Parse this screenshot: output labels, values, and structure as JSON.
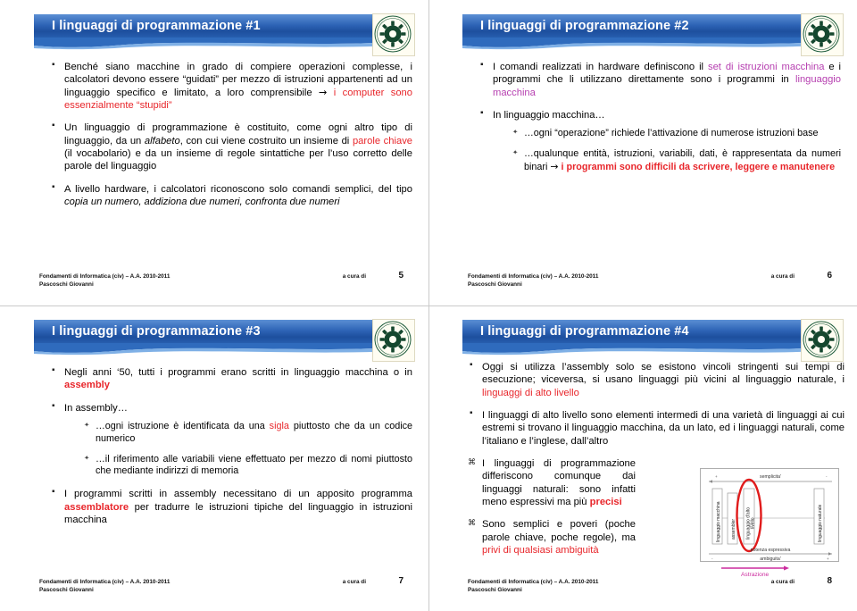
{
  "deck": {
    "logo_name": "polytechnic-gear-seal-logo",
    "colors": {
      "banner_blue_dark": "#1d4f9e",
      "banner_blue_light": "#5b8fd4",
      "highlight_red": "#e8262b",
      "highlight_magenta": "#b63fb0",
      "logo_green": "#1d5c3c"
    }
  },
  "footer_common": {
    "left_line1": "Fondamenti di Informatica (civ) – A.A. 2010-2011",
    "left_line2": "Pascoschi Giovanni",
    "center": "a cura di"
  },
  "slides": [
    {
      "title": "I linguaggi di programmazione #1",
      "page": "5",
      "bullets": [
        {
          "parts": [
            {
              "t": "Benché siano macchine in grado di compiere operazioni complesse, i calcolatori devono essere “guidati” per mezzo di istruzioni appartenenti ad un linguaggio specifico e limitato, a loro comprensibile ",
              "s": "normal"
            },
            {
              "t": "→ ",
              "s": "arrow"
            },
            {
              "t": "i computer sono essenzialmente “stupidi”",
              "s": "red"
            }
          ]
        },
        {
          "parts": [
            {
              "t": "Un linguaggio di programmazione è costituito, come ogni altro tipo di linguaggio, da un ",
              "s": "normal"
            },
            {
              "t": "alfabeto",
              "s": "italic"
            },
            {
              "t": ", con cui viene costruito un insieme di ",
              "s": "normal"
            },
            {
              "t": "parole chiave",
              "s": "red"
            },
            {
              "t": " (il vocabolario) e da un insieme di regole sintattiche per l’uso corretto delle parole del linguaggio",
              "s": "normal"
            }
          ]
        },
        {
          "parts": [
            {
              "t": "A livello hardware, i calcolatori riconoscono solo comandi semplici, del tipo ",
              "s": "normal"
            },
            {
              "t": "copia un numero, addiziona due numeri, confronta due numeri",
              "s": "italic"
            }
          ]
        }
      ]
    },
    {
      "title": "I linguaggi di programmazione #2",
      "page": "6",
      "bullets": [
        {
          "parts": [
            {
              "t": "I comandi realizzati in hardware definiscono il ",
              "s": "normal"
            },
            {
              "t": "set di istruzioni macchina",
              "s": "magenta"
            },
            {
              "t": " e i programmi che li utilizzano direttamente sono i programmi in ",
              "s": "normal"
            },
            {
              "t": "linguaggio macchina",
              "s": "magenta"
            }
          ]
        },
        {
          "parts": [
            {
              "t": "In linguaggio macchina…",
              "s": "normal"
            }
          ],
          "sub": [
            {
              "parts": [
                {
                  "t": "…ogni “operazione” richiede l’attivazione di numerose istruzioni base",
                  "s": "normal"
                }
              ]
            },
            {
              "parts": [
                {
                  "t": "…qualunque entità, istruzioni, variabili, dati, è rappresentata da numeri binari ",
                  "s": "normal"
                },
                {
                  "t": "→ ",
                  "s": "arrow"
                },
                {
                  "t": "i programmi sono difficili da scrivere, leggere e manutenere",
                  "s": "redbold"
                }
              ]
            }
          ]
        }
      ]
    },
    {
      "title": "I linguaggi di programmazione #3",
      "page": "7",
      "bullets": [
        {
          "parts": [
            {
              "t": "Negli anni ‘50, tutti i programmi erano scritti in linguaggio macchina o in ",
              "s": "normal"
            },
            {
              "t": "assembly",
              "s": "redbold"
            }
          ]
        },
        {
          "parts": [
            {
              "t": "In assembly…",
              "s": "normal"
            }
          ],
          "sub": [
            {
              "parts": [
                {
                  "t": "…ogni istruzione è identificata da una ",
                  "s": "normal"
                },
                {
                  "t": "sigla",
                  "s": "red"
                },
                {
                  "t": " piuttosto che da un codice numerico",
                  "s": "normal"
                }
              ]
            },
            {
              "parts": [
                {
                  "t": "…il riferimento alle variabili viene effettuato per mezzo di nomi piuttosto che mediante indirizzi di memoria",
                  "s": "normal"
                }
              ]
            }
          ]
        },
        {
          "parts": [
            {
              "t": "I programmi scritti in assembly necessitano di un apposito programma ",
              "s": "normal"
            },
            {
              "t": "assemblatore",
              "s": "redbold"
            },
            {
              "t": " per tradurre le istruzioni tipiche del linguaggio in istruzioni macchina",
              "s": "normal"
            }
          ]
        }
      ]
    },
    {
      "title": "I linguaggi di programmazione #4",
      "page": "8",
      "bullets": [
        {
          "parts": [
            {
              "t": "Oggi si utilizza l’assembly solo se esistono vincoli stringenti sui tempi di esecuzione; viceversa, si usano linguaggi più vicini al linguaggio naturale, i ",
              "s": "normal"
            },
            {
              "t": "linguaggi di alto livello",
              "s": "red"
            }
          ]
        },
        {
          "parts": [
            {
              "t": "I linguaggi di alto livello sono elementi intermedi di una varietà di linguaggi ai cui estremi si trovano il linguaggio macchina, da un lato, ed i linguaggi naturali, come l’italiano e l’inglese, dall’altro",
              "s": "normal"
            }
          ]
        },
        {
          "alt": true,
          "narrow": true,
          "parts": [
            {
              "t": "I linguaggi di programmazione differiscono comunque dai linguaggi naturali: sono infatti meno espressivi ma più ",
              "s": "normal"
            },
            {
              "t": "precisi",
              "s": "redbold"
            }
          ]
        },
        {
          "alt": true,
          "narrow": true,
          "parts": [
            {
              "t": "Sono semplici e poveri (poche parole chiave, poche regole), ma ",
              "s": "normal"
            },
            {
              "t": "privi di qualsiasi ambiguità",
              "s": "red"
            }
          ]
        }
      ],
      "diagram": {
        "top_label": "semplicita'",
        "bottom_label_1": "potenza espressiva",
        "bottom_label_2": "ambiguita'",
        "arrow_label": "Astrazione",
        "boxes": [
          "linguaggio macchina",
          "assembler",
          "linguaggio d'alto livello",
          "linguaggio naturale"
        ],
        "plus": "+",
        "minus": "-",
        "highlight_box": "linguaggio d'alto livello"
      }
    }
  ]
}
